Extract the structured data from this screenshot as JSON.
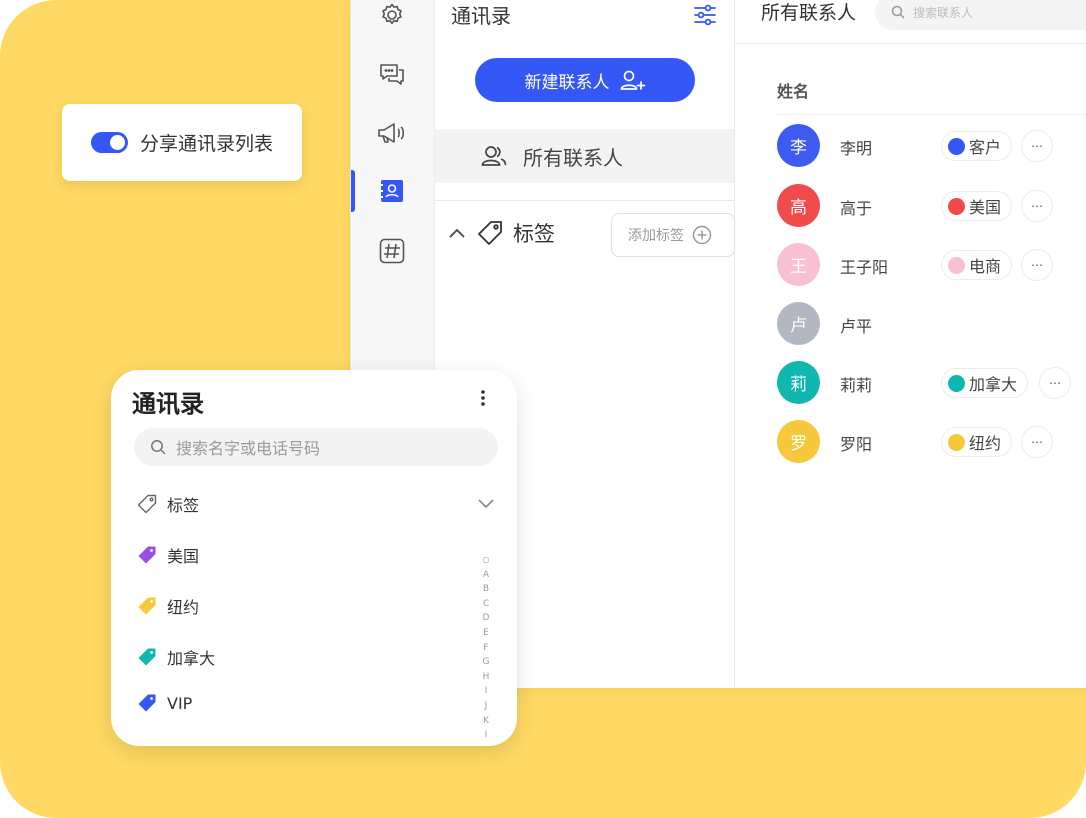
{
  "app": {
    "rail": {
      "items": [
        {
          "icon": "gear-icon"
        },
        {
          "icon": "chat-icon"
        },
        {
          "icon": "megaphone-icon"
        },
        {
          "icon": "contacts-book-icon",
          "active": true
        },
        {
          "icon": "hashtag-icon"
        }
      ]
    },
    "contacts_panel": {
      "title": "通讯录",
      "new_contact_label": "新建联系人",
      "all_contacts_label": "所有联系人",
      "tags_label": "标签",
      "add_tag_label": "添加标签"
    },
    "list": {
      "header_title": "所有联系人",
      "search_placeholder": "搜索联系人",
      "column_name": "姓名",
      "contacts": [
        {
          "initial": "李",
          "name": "李明",
          "color": "#3D5AF1",
          "tag": "客户",
          "tag_color": "#3457F5"
        },
        {
          "initial": "高",
          "name": "高于",
          "color": "#F04B4B",
          "tag": "美国",
          "tag_color": "#F04B4B"
        },
        {
          "initial": "王",
          "name": "王子阳",
          "color": "#F9BFD3",
          "tag": "电商",
          "tag_color": "#F9BFD3"
        },
        {
          "initial": "卢",
          "name": "卢平",
          "color": "#B3B7C3",
          "tag": "",
          "tag_color": ""
        },
        {
          "initial": "莉",
          "name": "莉莉",
          "color": "#10B7B0",
          "tag": "加拿大",
          "tag_color": "#10B7B0"
        },
        {
          "initial": "罗",
          "name": "罗阳",
          "color": "#F7C83B",
          "tag": "纽约",
          "tag_color": "#F7C83B"
        }
      ]
    }
  },
  "share_card": {
    "label": "分享通讯录列表",
    "toggle_on": true
  },
  "mobile": {
    "title": "通讯录",
    "search_placeholder": "搜索名字或电话号码",
    "tags_label": "标签",
    "tags": [
      {
        "label": "美国",
        "color": "#9B4DE8"
      },
      {
        "label": "纽约",
        "color": "#F7C83B"
      },
      {
        "label": "加拿大",
        "color": "#10B7B0"
      },
      {
        "label": "VIP",
        "color": "#3457F5"
      }
    ],
    "alphabet": [
      "A",
      "B",
      "C",
      "D",
      "E",
      "F",
      "G",
      "H",
      "I",
      "J",
      "K",
      "I"
    ]
  },
  "colors": {
    "accent": "#3457F5",
    "background": "#FFD963"
  }
}
